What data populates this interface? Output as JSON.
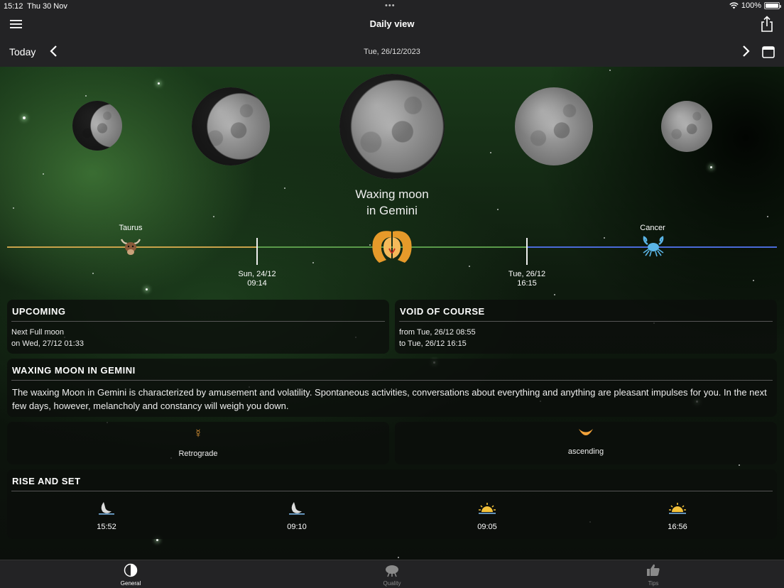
{
  "status": {
    "time": "15:12",
    "date": "Thu 30 Nov",
    "battery": "100%"
  },
  "nav": {
    "title": "Daily view",
    "today_label": "Today",
    "current_date": "Tue, 26/12/2023"
  },
  "hero": {
    "phase_line1": "Waxing moon",
    "phase_line2": "in Gemini",
    "signs": {
      "left": "Taurus",
      "right": "Cancer"
    },
    "transitions": [
      {
        "date": "Sun, 24/12",
        "time": "09:14"
      },
      {
        "date": "Tue, 26/12",
        "time": "16:15"
      }
    ]
  },
  "upcoming": {
    "title": "UPCOMING",
    "line1": "Next Full moon",
    "line2": "on Wed, 27/12 01:33"
  },
  "void_of_course": {
    "title": "VOID OF COURSE",
    "line1": "from Tue, 26/12 08:55",
    "line2": "to Tue, 26/12 16:15"
  },
  "description": {
    "title": "WAXING MOON IN GEMINI",
    "text": "The waxing Moon in Gemini is characterized by amusement and volatility. Spontaneous activities, conversations about everything and anything are pleasant impulses for you. In the next few days, however, melancholy and constancy will weigh you down."
  },
  "mercury": {
    "symbol": "☿",
    "label": "Retrograde"
  },
  "moon_direction": {
    "label": "ascending"
  },
  "rise_set": {
    "title": "RISE AND SET",
    "items": [
      {
        "icon": "moonrise-icon",
        "time": "15:52"
      },
      {
        "icon": "moonset-icon",
        "time": "09:10"
      },
      {
        "icon": "sunrise-icon",
        "time": "09:05"
      },
      {
        "icon": "sunset-icon",
        "time": "16:56"
      }
    ]
  },
  "tabs": [
    {
      "label": "General",
      "active": true
    },
    {
      "label": "Quality",
      "active": false
    },
    {
      "label": "Tips",
      "active": false
    }
  ],
  "colors": {
    "taurus_line": "#c8a24a",
    "gemini_line": "#5a9a4a",
    "cancer_line": "#4a6ad8",
    "accent": "#f2a23a"
  }
}
